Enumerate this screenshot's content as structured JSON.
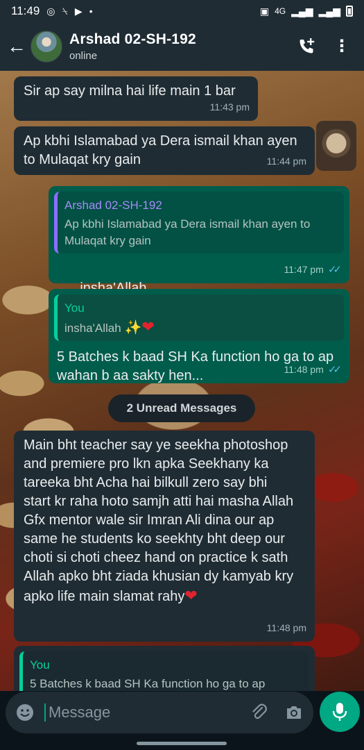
{
  "status_bar": {
    "time": "11:49",
    "network": "4G"
  },
  "header": {
    "back_label": "←",
    "contact_name": "Arshad 02-SH-192",
    "contact_status": "online",
    "menu_label": "⋮"
  },
  "messages": [
    {
      "direction": "incoming",
      "text": "Sir ap say milna hai life main 1 bar",
      "time": "11:43 pm"
    },
    {
      "direction": "incoming",
      "text": "Ap kbhi Islamabad ya Dera ismail khan ayen to Mulaqat kry gain",
      "time": "11:44 pm"
    },
    {
      "direction": "outgoing",
      "quote_name": "Arshad 02-SH-192",
      "quote_text": "Ap kbhi Islamabad ya Dera ismail khan ayen to Mulaqat kry gain",
      "text": "insha'Allah",
      "time": "11:47 pm",
      "ticks": "✓✓"
    },
    {
      "direction": "outgoing",
      "quote_name": "You",
      "quote_text": "insha'Allah",
      "text": "5 Batches k baad SH Ka function ho ga to ap wahan b aa sakty hen...",
      "time": "11:48 pm",
      "ticks": "✓✓"
    },
    {
      "direction": "incoming",
      "text": "Main bht teacher say ye seekha photoshop and premiere pro lkn apka Seekhany ka tareeka bht Acha hai bilkull zero say bhi start kr raha hoto samjh atti hai masha Allah Gfx mentor wale sir Imran Ali dina our ap same he students ko seekhty bht deep our choti si choti cheez hand on practice k sath Allah apko bht ziada khusian dy kamyab kry apko life main slamat rahy",
      "time": "11:48 pm"
    },
    {
      "direction": "incoming",
      "quote_name": "You",
      "quote_text": "5 Batches k baad SH Ka function ho ga to ap"
    }
  ],
  "unread_label": "2 Unread Messages",
  "emoji": {
    "sparkle": "✨",
    "heart": "❤"
  },
  "composer": {
    "placeholder": "Message"
  },
  "colors": {
    "incoming_bubble": "#202c33",
    "outgoing_bubble": "#005c4b",
    "accent": "#00a884",
    "read_ticks": "#53bdeb"
  }
}
